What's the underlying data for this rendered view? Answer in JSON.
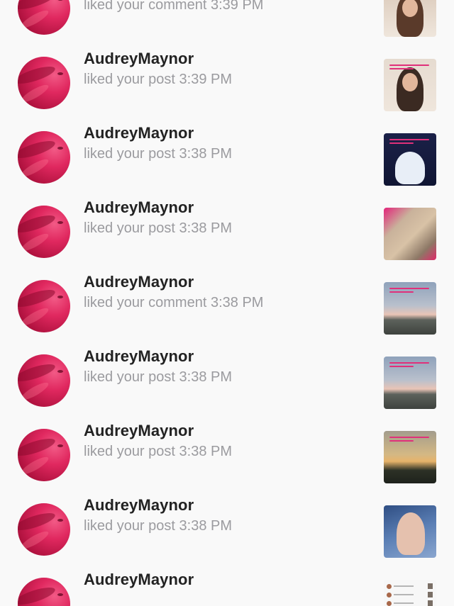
{
  "notifications": [
    {
      "username": "AudreyMaynor",
      "action": "liked your comment",
      "time": "3:39 PM",
      "avatar_icon": "profile-photo",
      "thumbnail": {
        "icon": "selfie-photo-thumbnail",
        "bg": "#d9c7b7",
        "accent": "#5a3a2a",
        "text_overlay": false
      }
    },
    {
      "username": "AudreyMaynor",
      "action": "liked your post",
      "time": "3:39 PM",
      "avatar_icon": "profile-photo",
      "thumbnail": {
        "icon": "selfie-photo-thumbnail",
        "bg": "#e6dbd0",
        "accent": "#3b2a22",
        "text_overlay": true
      }
    },
    {
      "username": "AudreyMaynor",
      "action": "liked your post",
      "time": "3:38 PM",
      "avatar_icon": "profile-photo",
      "thumbnail": {
        "icon": "princess-dress-thumbnail",
        "bg": "#141a3a",
        "accent": "#dfe8f5",
        "text_overlay": true
      }
    },
    {
      "username": "AudreyMaynor",
      "action": "liked your post",
      "time": "3:38 PM",
      "avatar_icon": "profile-photo",
      "thumbnail": {
        "icon": "blonde-hair-thumbnail",
        "bg": "#b09a86",
        "accent": "#e02a6a",
        "text_overlay": false
      }
    },
    {
      "username": "AudreyMaynor",
      "action": "liked your comment",
      "time": "3:38 PM",
      "avatar_icon": "profile-photo",
      "thumbnail": {
        "icon": "sky-landscape-thumbnail",
        "bg": "#a9b6c8",
        "accent": "#555a52",
        "text_overlay": true
      }
    },
    {
      "username": "AudreyMaynor",
      "action": "liked your post",
      "time": "3:38 PM",
      "avatar_icon": "profile-photo",
      "thumbnail": {
        "icon": "sky-landscape-thumbnail",
        "bg": "#a7b3c4",
        "accent": "#4e5450",
        "text_overlay": true
      }
    },
    {
      "username": "AudreyMaynor",
      "action": "liked your post",
      "time": "3:38 PM",
      "avatar_icon": "profile-photo",
      "thumbnail": {
        "icon": "sunset-trees-thumbnail",
        "bg": "#8f8a80",
        "accent": "#2b3128",
        "text_overlay": true
      }
    },
    {
      "username": "AudreyMaynor",
      "action": "liked your post",
      "time": "3:38 PM",
      "avatar_icon": "profile-photo",
      "thumbnail": {
        "icon": "hand-nails-thumbnail",
        "bg": "#3f5f8f",
        "accent": "#e7c4b2",
        "text_overlay": false
      }
    },
    {
      "username": "AudreyMaynor",
      "action": "",
      "time": "",
      "avatar_icon": "profile-photo",
      "thumbnail": {
        "icon": "screenshot-list-thumbnail",
        "bg": "#f6f6f6",
        "accent": "#a8684a",
        "text_overlay": false
      }
    }
  ]
}
